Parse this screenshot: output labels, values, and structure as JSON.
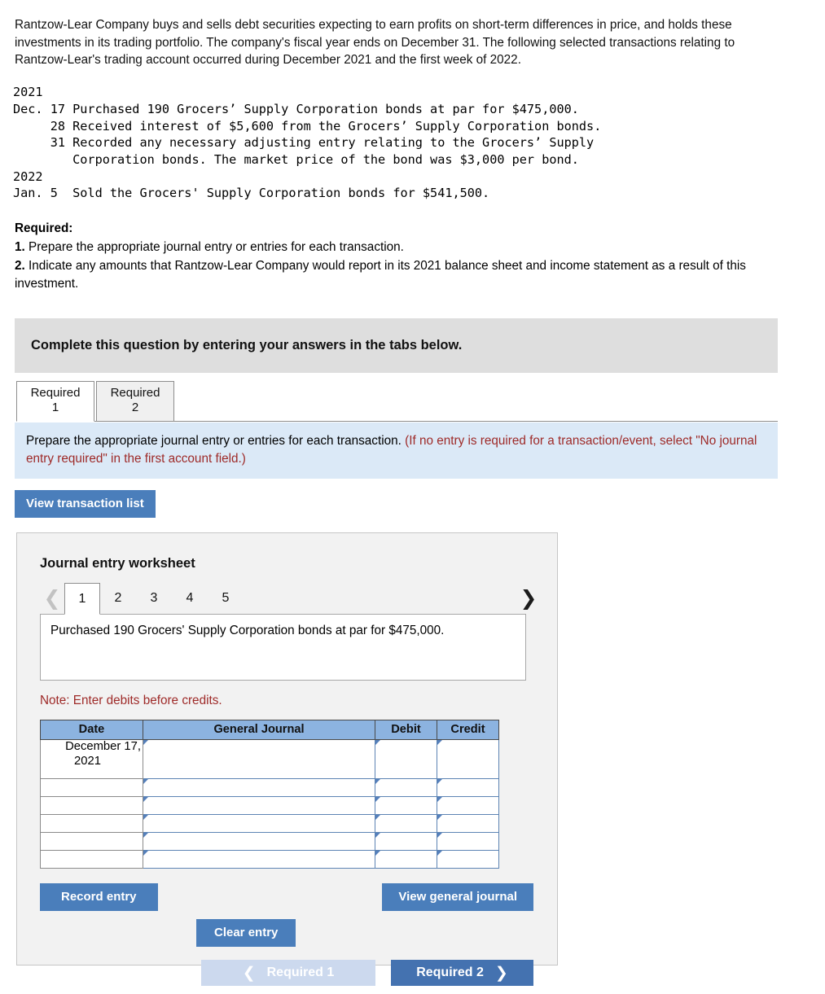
{
  "intro": "Rantzow-Lear Company buys and sells debt securities expecting to earn profits on short-term differences in price, and holds these investments in its trading portfolio. The company's fiscal year ends on December 31. The following selected transactions relating to Rantzow-Lear's trading account occurred during December 2021 and the first week of 2022.",
  "transactions_block": "2021\nDec. 17 Purchased 190 Grocers’ Supply Corporation bonds at par for $475,000.\n     28 Received interest of $5,600 from the Grocers’ Supply Corporation bonds.\n     31 Recorded any necessary adjusting entry relating to the Grocers’ Supply\n        Corporation bonds. The market price of the bond was $3,000 per bond.\n2022\nJan. 5  Sold the Grocers' Supply Corporation bonds for $541,500.",
  "required": {
    "heading": "Required:",
    "item1_num": "1.",
    "item1_text": " Prepare the appropriate journal entry or entries for each transaction.",
    "item2_num": "2.",
    "item2_text": " Indicate any amounts that Rantzow-Lear Company would report in its 2021 balance sheet and income statement as a result of this investment."
  },
  "banner": {
    "text": "Complete this question by entering your answers in the tabs below."
  },
  "tabs": [
    {
      "label_line1": "Required",
      "label_line2": "1",
      "active": true
    },
    {
      "label_line1": "Required",
      "label_line2": "2",
      "active": false
    }
  ],
  "instruction": {
    "black": "Prepare the appropriate journal entry or entries for each transaction. ",
    "red": "(If no entry is required for a transaction/event, select \"No journal entry required\" in the first account field.)"
  },
  "view_transaction_list_label": "View transaction list",
  "worksheet": {
    "title": "Journal entry worksheet",
    "pages": [
      "1",
      "2",
      "3",
      "4",
      "5"
    ],
    "active_page": "1",
    "prev_icon": "chevron-left-icon",
    "next_icon": "chevron-right-icon",
    "description": "Purchased 190 Grocers' Supply Corporation bonds at par for $475,000.",
    "note": "Note: Enter debits before credits.",
    "table": {
      "headers": [
        "Date",
        "General Journal",
        "Debit",
        "Credit"
      ],
      "rows": [
        {
          "date_line1": "December 17,",
          "date_line2": "2021",
          "general_journal": "",
          "debit": "",
          "credit": "",
          "tall": true
        },
        {
          "date_line1": "",
          "date_line2": "",
          "general_journal": "",
          "debit": "",
          "credit": "",
          "tall": false
        },
        {
          "date_line1": "",
          "date_line2": "",
          "general_journal": "",
          "debit": "",
          "credit": "",
          "tall": false
        },
        {
          "date_line1": "",
          "date_line2": "",
          "general_journal": "",
          "debit": "",
          "credit": "",
          "tall": false
        },
        {
          "date_line1": "",
          "date_line2": "",
          "general_journal": "",
          "debit": "",
          "credit": "",
          "tall": false
        },
        {
          "date_line1": "",
          "date_line2": "",
          "general_journal": "",
          "debit": "",
          "credit": "",
          "tall": false
        }
      ]
    },
    "record_entry_label": "Record entry",
    "clear_entry_label": "Clear entry",
    "view_general_journal_label": "View general journal"
  },
  "bottom_nav": {
    "prev_label": "Required 1",
    "next_label": "Required 2",
    "prev_icon": "chevron-left-icon",
    "next_icon": "chevron-right-icon"
  },
  "colors": {
    "accent_blue": "#4a7ebb",
    "table_header_blue": "#8cb3e0",
    "info_box_blue": "#dbe9f7",
    "banner_gray": "#dedede",
    "note_red": "#9e2a28",
    "nav_disabled_blue": "#ccd9ee",
    "nav_active_blue": "#4472b0"
  }
}
